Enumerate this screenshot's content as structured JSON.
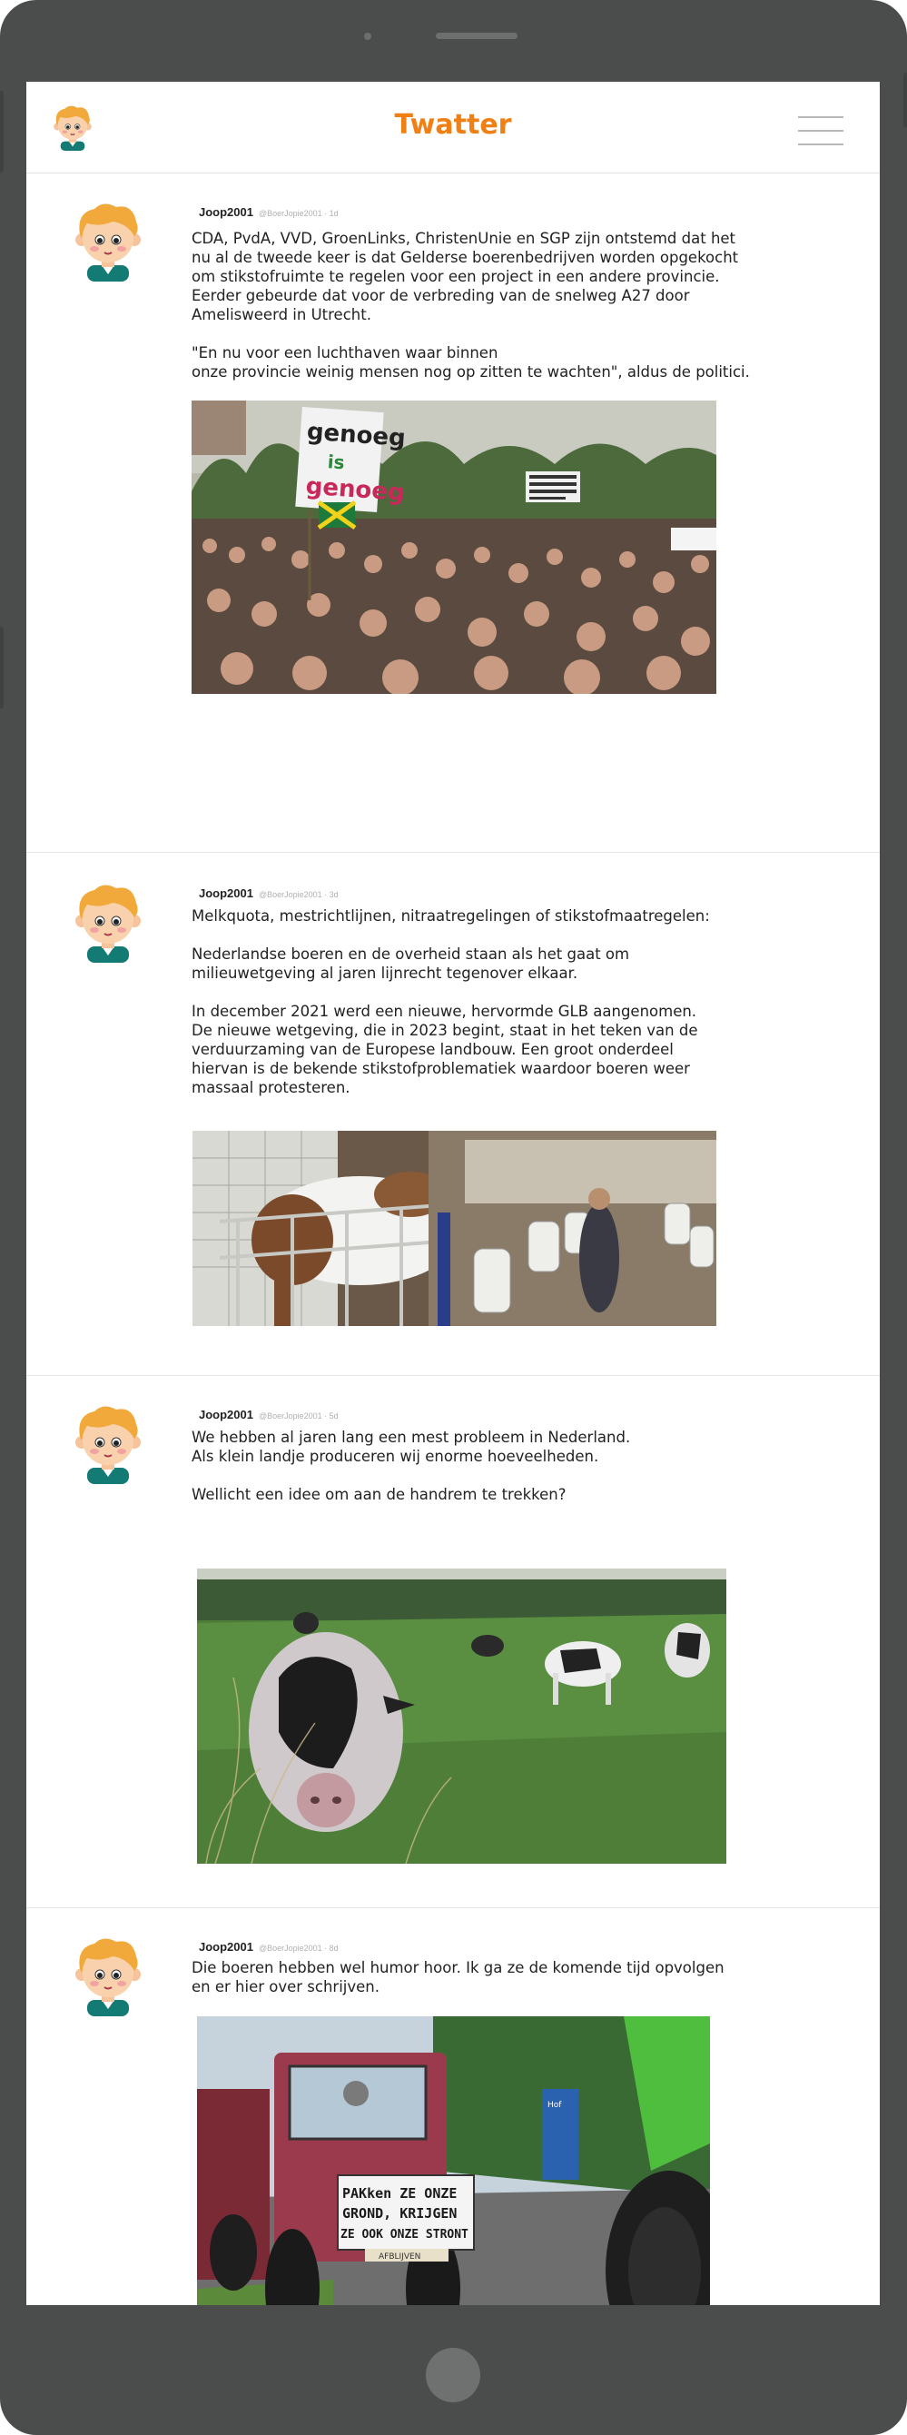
{
  "app": {
    "title": "Twatter"
  },
  "posts": [
    {
      "user": "Joop2001",
      "handle": "@BoerJopie2001 · 1d",
      "text": "CDA, PvdA, VVD, GroenLinks, ChristenUnie en SGP zijn ontstemd dat het\nnu al de tweede keer is dat Gelderse boerenbedrijven worden opgekocht\nom stikstofruimte te regelen voor een project in een andere provincie.\nEerder gebeurde dat voor de verbreding van de snelweg A27 door\nAmelisweerd in Utrecht.\n\n\"En nu voor een luchthaven waar binnen\nonze provincie weinig mensen nog op zitten te wachten\", aldus de politici.",
      "sign_text": "genoeg is genoeg"
    },
    {
      "user": "Joop2001",
      "handle": "@BoerJopie2001 · 3d",
      "text": "Melkquota, mestrichtlijnen, nitraatregelingen of stikstofmaatregelen:\n\nNederlandse boeren en de overheid staan als het gaat om\nmilieuwetgeving al jaren lijnrecht tegenover elkaar.\n\nIn december 2021 werd een nieuwe, hervormde GLB aangenomen.\nDe nieuwe wetgeving, die in 2023 begint, staat in het teken van de\n verduurzaming van de Europese landbouw. Een groot onderdeel\nhiervan is de bekende stikstofproblematiek waardoor boeren weer\nmassaal protesteren."
    },
    {
      "user": "Joop2001",
      "handle": "@BoerJopie2001 · 5d",
      "text": "We hebben al jaren lang een mest probleem in Nederland.\nAls klein landje produceren wij enorme hoeveelheden.\n\nWellicht een idee om aan de handrem te trekken?"
    },
    {
      "user": "Joop2001",
      "handle": "@BoerJopie2001 · 8d",
      "text": "Die boeren hebben wel humor hoor. Ik ga ze de komende tijd opvolgen\nen er hier over schrijven.",
      "sign_text": "PAKken ZE ONZE\nGROND, KRIJGEN\nZE OOK ONZE STRONT",
      "sign_small": "AFBLIJVEN"
    }
  ],
  "colors": {
    "accent": "#f07f14",
    "device": "#4a4d4c"
  },
  "icons": {
    "menu": "hamburger-menu-icon",
    "avatar": "farmer-boy-avatar"
  }
}
